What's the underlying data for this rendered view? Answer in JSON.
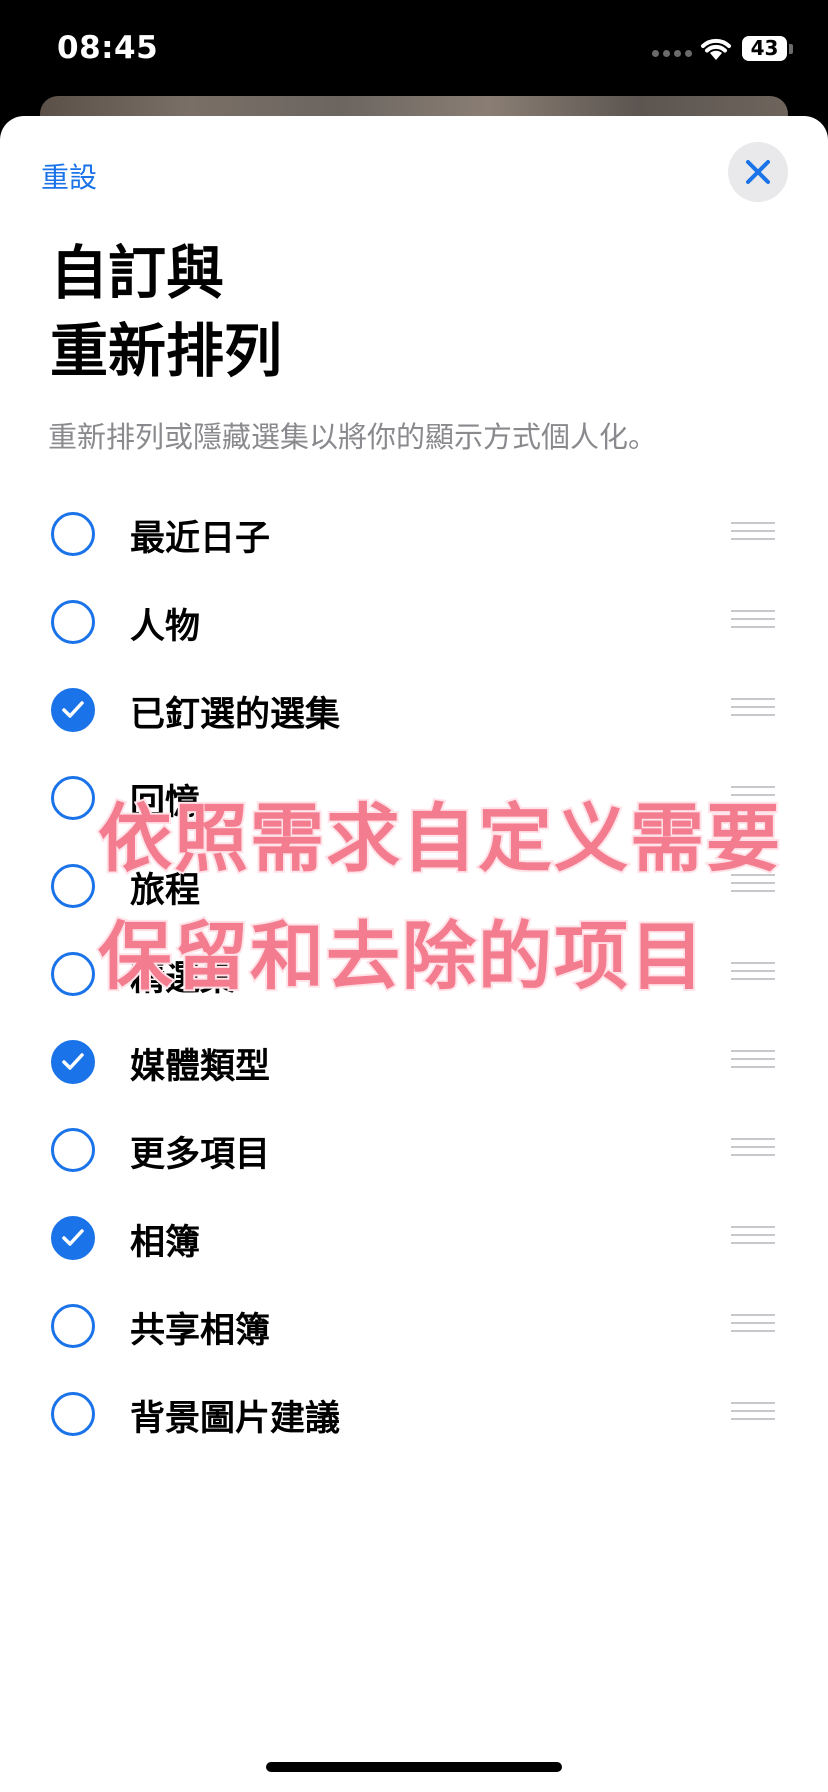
{
  "status_bar": {
    "time": "08:45",
    "battery": "43"
  },
  "header": {
    "reset_label": "重設",
    "close_icon": "close-icon",
    "title_line1": "自訂與",
    "title_line2": "重新排列",
    "subtitle": "重新排列或隱藏選集以將你的顯示方式個人化。"
  },
  "items": [
    {
      "label": "最近日子",
      "checked": false
    },
    {
      "label": "人物",
      "checked": false
    },
    {
      "label": "已釘選的選集",
      "checked": true
    },
    {
      "label": "回憶",
      "checked": false
    },
    {
      "label": "旅程",
      "checked": false
    },
    {
      "label": "精選集",
      "checked": false
    },
    {
      "label": "媒體類型",
      "checked": true
    },
    {
      "label": "更多項目",
      "checked": false
    },
    {
      "label": "相簿",
      "checked": true
    },
    {
      "label": "共享相簿",
      "checked": false
    },
    {
      "label": "背景圖片建議",
      "checked": false
    }
  ],
  "overlay": {
    "line1": "依照需求自定义需要",
    "line2": "保留和去除的项目"
  },
  "colors": {
    "accent": "#1a73e8",
    "overlay_text": "#f47c8f"
  }
}
